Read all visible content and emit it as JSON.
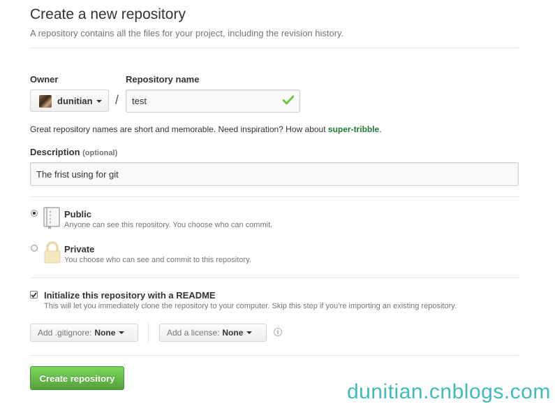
{
  "header": {
    "title": "Create a new repository",
    "subtitle": "A repository contains all the files for your project, including the revision history."
  },
  "owner": {
    "label": "Owner",
    "value": "dunitian"
  },
  "repo_name": {
    "label": "Repository name",
    "value": "test",
    "separator": "/"
  },
  "hint": {
    "prefix": "Great repository names are short and memorable. Need inspiration? How about ",
    "suggestion": "super-tribble",
    "suffix": "."
  },
  "description": {
    "label": "Description",
    "optional": "(optional)",
    "value": "The frist using for git"
  },
  "visibility": {
    "public": {
      "title": "Public",
      "desc": "Anyone can see this repository. You choose who can commit.",
      "checked": true
    },
    "private": {
      "title": "Private",
      "desc": "You choose who can see and commit to this repository.",
      "checked": false
    }
  },
  "readme": {
    "label": "Initialize this repository with a README",
    "desc": "This will let you immediately clone the repository to your computer. Skip this step if you’re importing an existing repository.",
    "checked": true
  },
  "gitignore": {
    "label": "Add .gitignore:",
    "value": "None"
  },
  "license": {
    "label": "Add a license:",
    "value": "None"
  },
  "info_icon": "i",
  "submit": {
    "label": "Create repository"
  },
  "watermark": "dunitian.cnblogs.com",
  "colors": {
    "accent_green": "#6cc644",
    "suggestion": "#1e7b34",
    "watermark": "#3fbcb8"
  }
}
